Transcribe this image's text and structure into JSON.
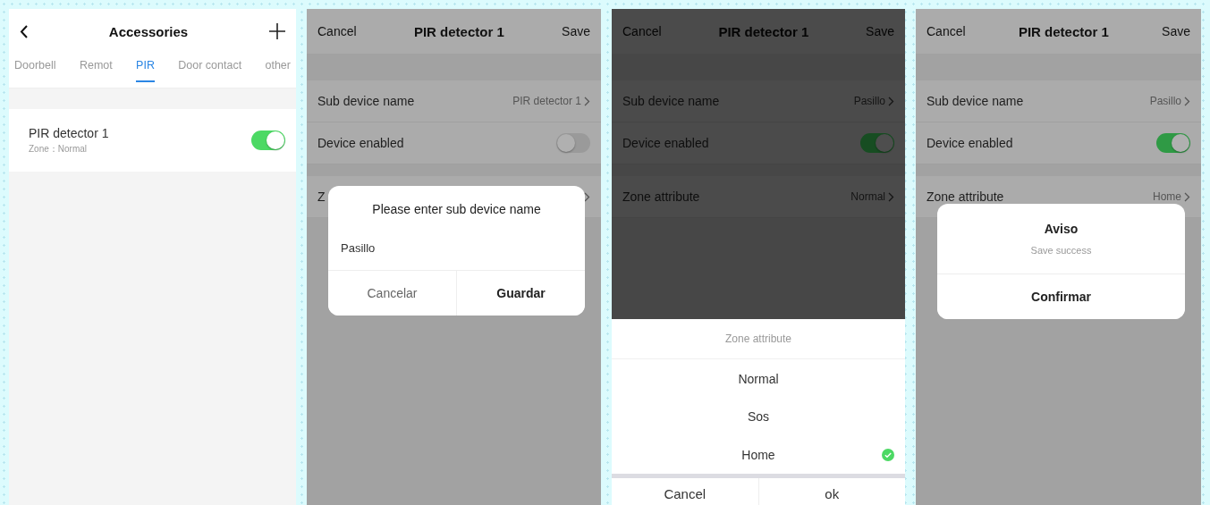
{
  "screens": [
    {
      "kind": "list",
      "title": "Accessories",
      "tabs": [
        {
          "label": "Doorbell",
          "selected": false
        },
        {
          "label": "Remot",
          "selected": false
        },
        {
          "label": "PIR",
          "selected": true
        },
        {
          "label": "Door contact",
          "selected": false
        },
        {
          "label": "other",
          "selected": false
        }
      ],
      "items": [
        {
          "name": "PIR detector 1",
          "zone": "Zone：Normal",
          "on": true
        }
      ]
    },
    {
      "kind": "detail",
      "left": "Cancel",
      "title": "PIR detector 1",
      "right": "Save",
      "rows": [
        {
          "kind": "value",
          "label": "Sub device name",
          "value": "PIR detector 1"
        },
        {
          "kind": "toggle",
          "label": "Device enabled",
          "on": false
        },
        {
          "kind": "value",
          "label": "Z"
        }
      ],
      "dialog": {
        "kind": "prompt",
        "title": "Please enter sub device name",
        "value": "Pasillo",
        "buttons": [
          "Cancelar",
          "Guardar"
        ]
      }
    },
    {
      "kind": "detail",
      "left": "Cancel",
      "title": "PIR detector 1",
      "right": "Save",
      "rows": [
        {
          "kind": "value",
          "label": "Sub device name",
          "value": "Pasillo"
        },
        {
          "kind": "toggle",
          "label": "Device enabled",
          "on": true
        },
        {
          "kind": "value",
          "label": "Zone attribute",
          "value": "Normal"
        }
      ],
      "dialog": {
        "kind": "sheet",
        "title": "Zone attribute",
        "options": [
          {
            "label": "Normal",
            "selected": false
          },
          {
            "label": "Sos",
            "selected": false
          },
          {
            "label": "Home",
            "selected": true
          }
        ],
        "buttons": [
          "Cancel",
          "ok"
        ]
      }
    },
    {
      "kind": "detail",
      "left": "Cancel",
      "title": "PIR detector 1",
      "right": "Save",
      "rows": [
        {
          "kind": "value",
          "label": "Sub device name",
          "value": "Pasillo"
        },
        {
          "kind": "toggle",
          "label": "Device enabled",
          "on": true
        },
        {
          "kind": "value",
          "label": "Zone attribute",
          "value": "Home"
        }
      ],
      "dialog": {
        "kind": "alert",
        "title": "Aviso",
        "message": "Save success",
        "buttons": [
          "Confirmar"
        ]
      }
    }
  ]
}
